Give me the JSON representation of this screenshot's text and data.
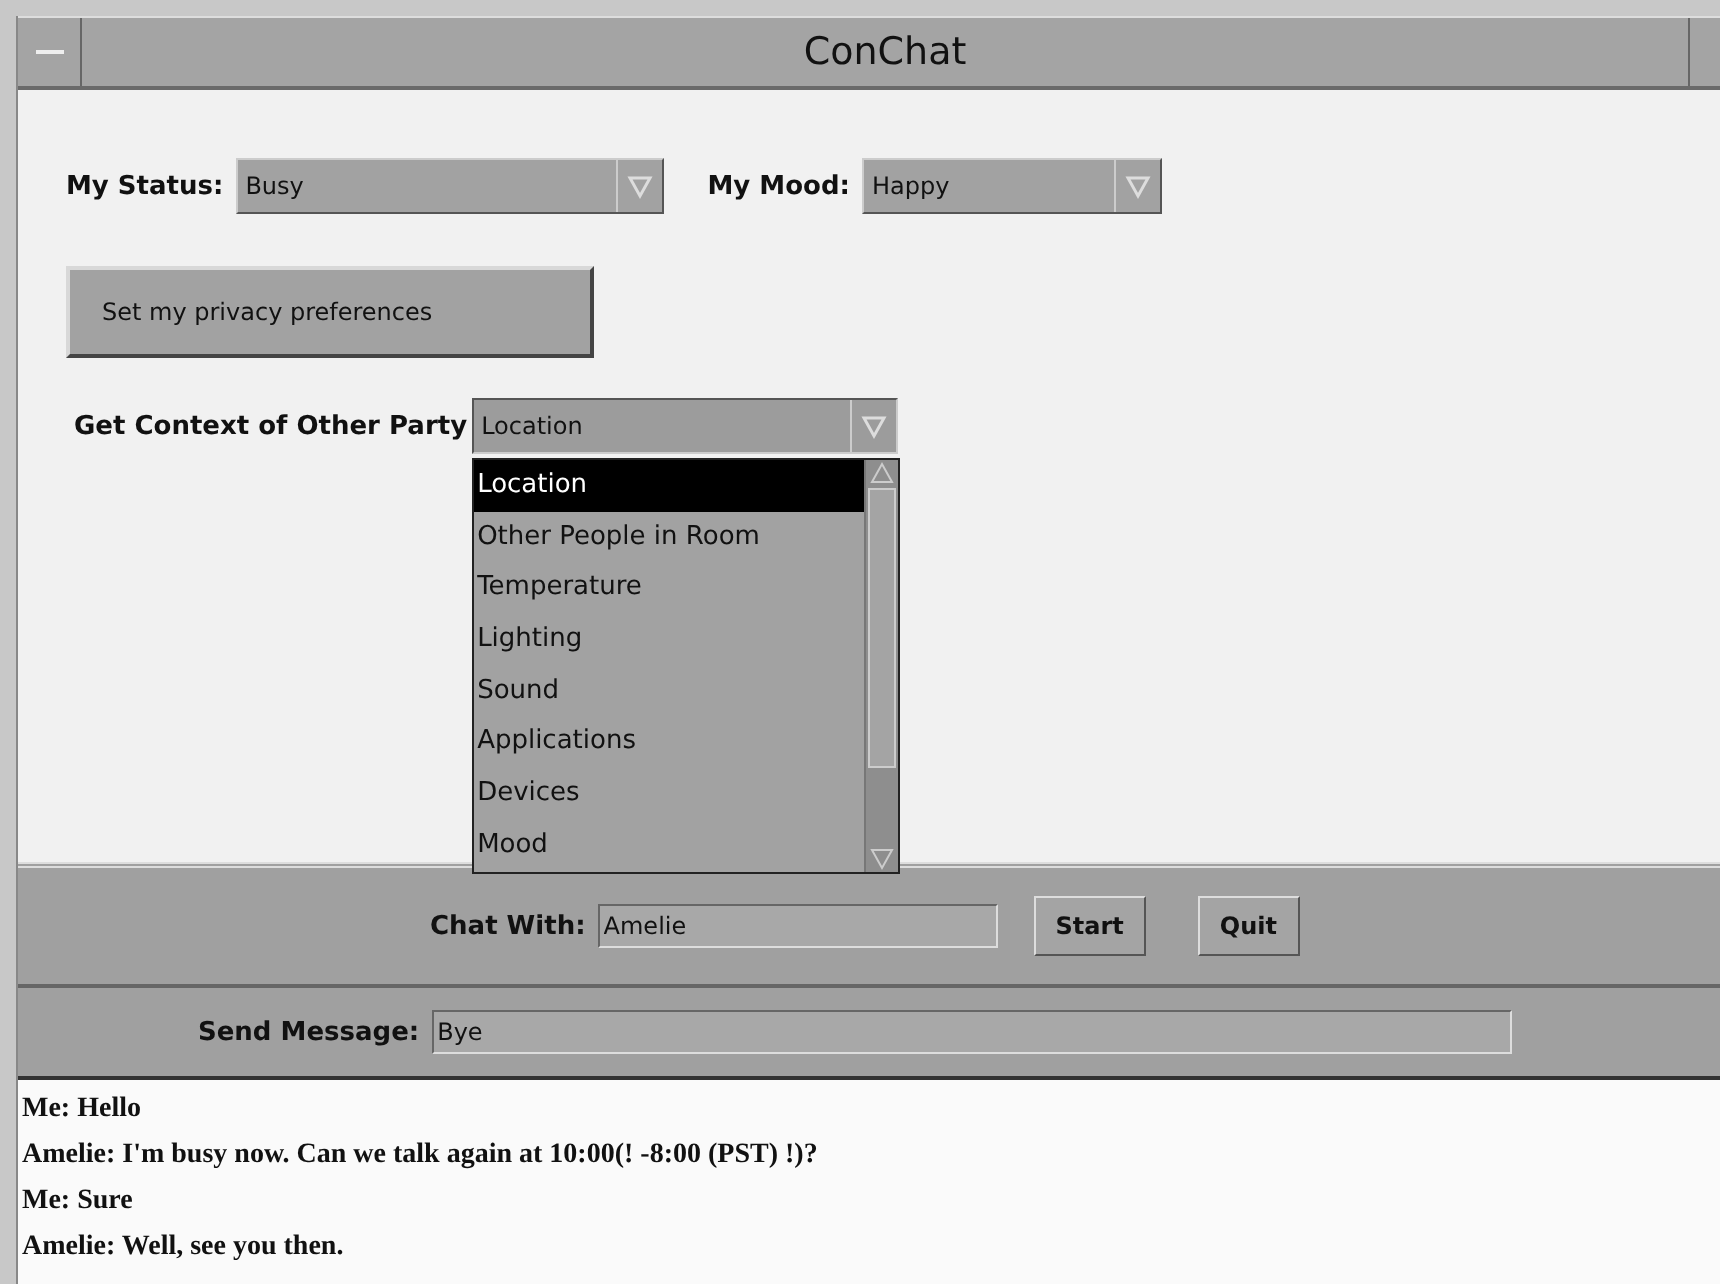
{
  "window": {
    "title": "ConChat"
  },
  "status": {
    "label": "My Status:",
    "value": "Busy"
  },
  "mood": {
    "label": "My Mood:",
    "value": "Happy"
  },
  "privacy_button": "Set my privacy preferences",
  "context": {
    "label": "Get Context of Other Party",
    "value": "Location",
    "expanded": true,
    "options": [
      {
        "label": "Location",
        "selected": true
      },
      {
        "label": "Other People in Room",
        "selected": false
      },
      {
        "label": "Temperature",
        "selected": false
      },
      {
        "label": "Lighting",
        "selected": false
      },
      {
        "label": "Sound",
        "selected": false
      },
      {
        "label": "Applications",
        "selected": false
      },
      {
        "label": "Devices",
        "selected": false
      },
      {
        "label": "Mood",
        "selected": false
      }
    ]
  },
  "chat_with": {
    "label": "Chat With:",
    "value": "Amelie"
  },
  "buttons": [
    "Start",
    "Quit"
  ],
  "send_message": {
    "label": "Send Message:",
    "value": "Bye"
  },
  "messages": [
    "Me: Hello",
    "Amelie: I'm busy now. Can we talk again at 10:00(! -8:00 (PST) !)?",
    "Me: Sure",
    "Amelie: Well, see you then."
  ]
}
